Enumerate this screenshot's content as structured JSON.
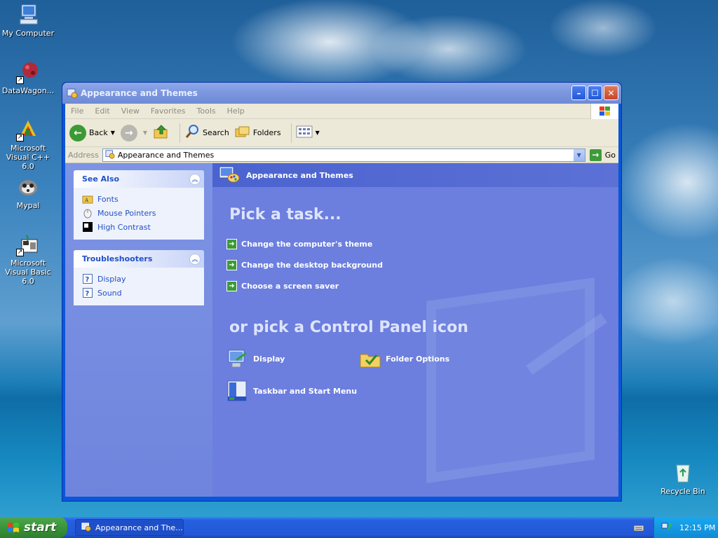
{
  "desktop": {
    "icons": [
      {
        "label": "My Computer"
      },
      {
        "label": "DataWagon..."
      },
      {
        "label": "Microsoft Visual C++ 6.0"
      },
      {
        "label": "Mypal"
      },
      {
        "label": "Microsoft Visual Basic 6.0"
      },
      {
        "label": "Recycle Bin"
      }
    ]
  },
  "window": {
    "title": "Appearance and Themes",
    "menu": [
      "File",
      "Edit",
      "View",
      "Favorites",
      "Tools",
      "Help"
    ],
    "toolbar": {
      "back": "Back",
      "search": "Search",
      "folders": "Folders"
    },
    "address": {
      "label": "Address",
      "value": "Appearance and Themes",
      "go": "Go"
    }
  },
  "sidebar": {
    "see_also": {
      "title": "See Also",
      "items": [
        {
          "label": "Fonts"
        },
        {
          "label": "Mouse Pointers"
        },
        {
          "label": "High Contrast"
        }
      ]
    },
    "troubleshooters": {
      "title": "Troubleshooters",
      "items": [
        {
          "label": "Display"
        },
        {
          "label": "Sound"
        }
      ]
    }
  },
  "main": {
    "header": "Appearance and Themes",
    "pick_task": "Pick a task...",
    "tasks": [
      {
        "label": "Change the computer's theme"
      },
      {
        "label": "Change the desktop background"
      },
      {
        "label": "Choose a screen saver"
      }
    ],
    "pick_icon": "or pick a Control Panel icon",
    "icons": [
      {
        "label": "Display"
      },
      {
        "label": "Folder Options"
      },
      {
        "label": "Taskbar and Start Menu"
      }
    ]
  },
  "taskbar": {
    "start": "start",
    "task_button": "Appearance and The...",
    "clock": "12:15 PM"
  },
  "colors": {
    "title_bar": "#7d98e0",
    "left_pane": "#7d94e4",
    "right_pane": "#6c7ede",
    "link": "#2250c6",
    "start_green": "#3a943a",
    "taskbar_blue": "#2257d6"
  }
}
